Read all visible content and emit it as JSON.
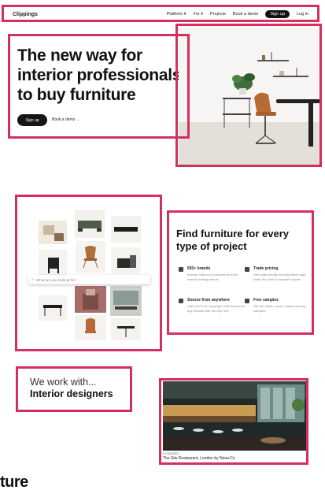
{
  "nav": {
    "logo": "Clippings",
    "links": [
      "Platform ▾",
      "For ▾",
      "Projects",
      "Book a demo"
    ],
    "signup": "Sign up",
    "login": "Log in"
  },
  "hero": {
    "title_lines": [
      "The new way for",
      "interior professionals",
      "to buy furniture"
    ],
    "signup_button": "Sign up",
    "demo_link": "Book a demo →"
  },
  "collage": {
    "search_placeholder": "What are you looking for?"
  },
  "find": {
    "title": "Find furniture for every type of project",
    "features": [
      {
        "title": "650+ brands",
        "text": "Browse millions of products from the world's leading brands",
        "icon": "grid-icon"
      },
      {
        "title": "Trade pricing",
        "text": "See trade pricing and lead times right away. No need to request a quote.",
        "icon": "tag-icon"
      },
      {
        "title": "Source from anywhere",
        "text": "Can't find it on Clippings? Add items from any website with the Clip Tool.",
        "icon": "document-icon"
      },
      {
        "title": "Free samples",
        "text": "Get free fabric, wood, marble and rug samples.",
        "icon": "box-icon"
      }
    ]
  },
  "work": {
    "line1": "We work with...",
    "line2": "Interior designers"
  },
  "showcase": {
    "category": "Hospitality",
    "caption": "The Site Restaurant, London by Nina+Co"
  },
  "overflow_text": "ture",
  "colors": {
    "highlight": "#d32f5f",
    "button": "#161616"
  }
}
